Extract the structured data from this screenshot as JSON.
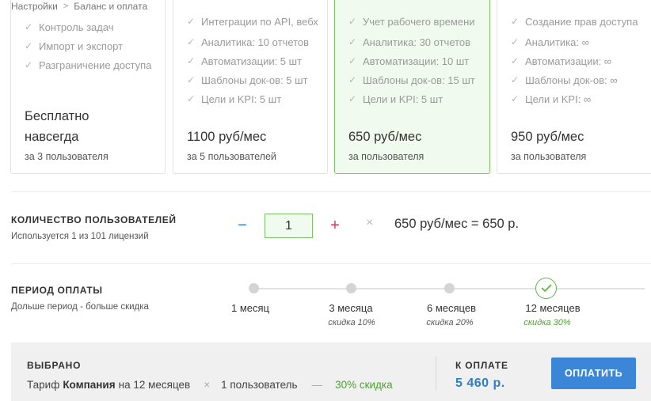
{
  "breadcrumb": {
    "parent": "Настройки",
    "current": "Баланс и оплата"
  },
  "plans": [
    {
      "features": [
        "Контроль задач",
        "Импорт и экспорт",
        "Разграничение доступа"
      ],
      "price_line1": "Бесплатно",
      "price_line2": "навсегда",
      "subtitle": "за 3 пользователя"
    },
    {
      "features_partial": "Интеграции по АРІ, вебх",
      "features": [
        "Аналитика: 10 отчетов",
        "Автоматизации: 5 шт",
        "Шаблоны док-ов: 5 шт",
        "Цели и KPI: 5 шт"
      ],
      "price": "1100 руб/мес",
      "subtitle": "за 5 пользователей"
    },
    {
      "features_partial": "Учет рабочего времени",
      "features": [
        "Аналитика: 30 отчетов",
        "Автоматизации: 10 шт",
        "Шаблоны док-ов: 15 шт",
        "Цели и KPI: 5 шт"
      ],
      "price": "650 руб/мес",
      "subtitle": "за пользователя",
      "selected": true
    },
    {
      "features_partial": "Создание прав доступа",
      "features": [
        "Аналитика: ∞",
        "Автоматизации: ∞",
        "Шаблоны док-ов: ∞",
        "Цели и KPI: ∞"
      ],
      "price": "950 руб/мес",
      "subtitle": "за пользователя"
    }
  ],
  "quantity": {
    "title": "КОЛИЧЕСТВО ПОЛЬЗОВАТЕЛЕЙ",
    "hint": "Используется 1 из 101 лицензий",
    "minus": "−",
    "value": "1",
    "plus": "+",
    "times": "×",
    "result": "650 руб/мес = 650 р."
  },
  "period": {
    "title": "ПЕРИОД ОПЛАТЫ",
    "hint": "Дольше период - больше скидка",
    "options": [
      {
        "label": "1 месяц",
        "discount": ""
      },
      {
        "label": "3 месяца",
        "discount": "скидка 10%"
      },
      {
        "label": "6 месяцев",
        "discount": "скидка 20%"
      },
      {
        "label": "12 месяцев",
        "discount": "скидка 30%",
        "selected": true
      }
    ]
  },
  "summary": {
    "title": "ВЫБРАНО",
    "tariff_prefix": "Тариф",
    "tariff_name": "Компания",
    "tariff_suffix": "на 12 месяцев",
    "times": "×",
    "users": "1 пользователь",
    "dash": "—",
    "discount": "30% скидка",
    "pay_title": "К ОПЛАТЕ",
    "amount": "5 460 р.",
    "pay_button": "ОПЛАТИТЬ"
  },
  "colors": {
    "accent_blue": "#3c86d8",
    "selected_green": "#5fb548",
    "plus_red": "#d23a5e"
  },
  "icons": {
    "check": "check-icon",
    "chevron": "chevron-right-icon"
  }
}
